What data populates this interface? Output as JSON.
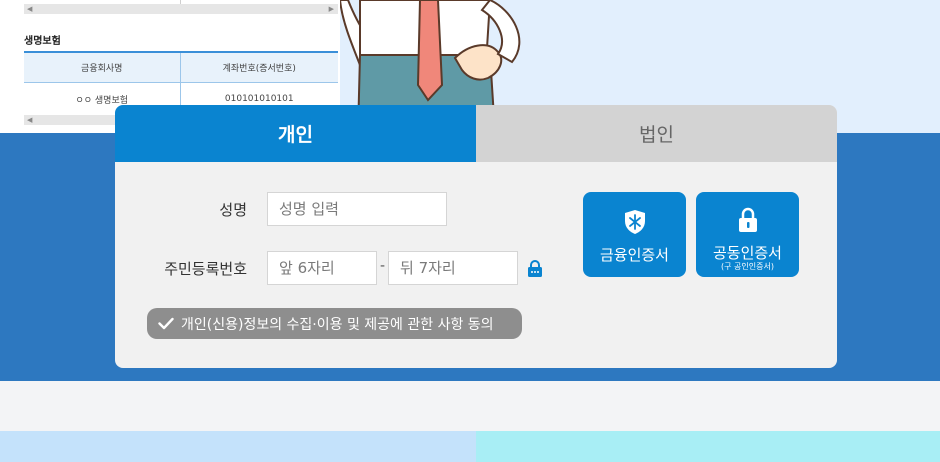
{
  "background": {
    "doc": {
      "section_title": "생명보험",
      "columns": [
        "금융회사명",
        "계좌번호(증서번호)"
      ],
      "rows": [
        [
          "ㅇㅇ 생명보험",
          "010101010101"
        ]
      ]
    }
  },
  "tabs": [
    {
      "label": "개인",
      "active": true
    },
    {
      "label": "법인",
      "active": false
    }
  ],
  "form": {
    "name_label": "성명",
    "name_placeholder": "성명 입력",
    "rrn_label": "주민등록번호",
    "rrn_front_placeholder": "앞 6자리",
    "rrn_separator": "-",
    "rrn_back_placeholder": "뒤 7자리",
    "lock_icon": "lock-icon"
  },
  "buttons": {
    "financial_cert": {
      "label": "금융인증서",
      "icon": "shield-icon"
    },
    "joint_cert": {
      "label": "공동인증서",
      "sublabel": "(구 공인인증서)",
      "icon": "lock-icon"
    }
  },
  "consent": {
    "label": "개인(신용)정보의 수집·이용 및 제공에 관한 사항 동의",
    "icon": "check-icon"
  },
  "colors": {
    "primary": "#0a84d0",
    "band": "#2d78c0",
    "inactive_tab": "#d3d3d3",
    "consent": "#8e8e8e"
  }
}
